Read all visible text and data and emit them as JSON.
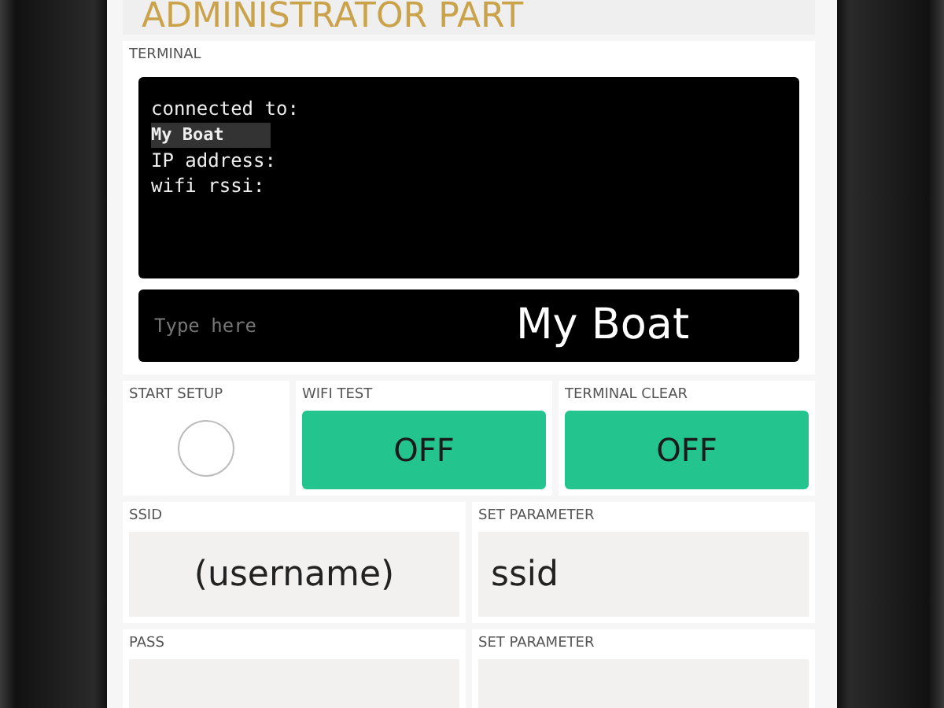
{
  "title": "ADMINISTRATOR PART",
  "terminal": {
    "label": "TERMINAL",
    "lines": [
      {
        "text": "connected to:",
        "highlighted": false
      },
      {
        "text": "My Boat",
        "highlighted": true
      },
      {
        "text": "IP address:",
        "highlighted": false
      },
      {
        "text": "wifi rssi:",
        "highlighted": false
      }
    ],
    "input": {
      "placeholder": "Type here",
      "value": "My Boat"
    }
  },
  "controls": [
    {
      "kind": "led",
      "label": "START SETUP",
      "on": false
    },
    {
      "kind": "button",
      "label": "WIFI TEST",
      "text": "OFF"
    },
    {
      "kind": "button",
      "label": "TERMINAL CLEAR",
      "text": "OFF"
    }
  ],
  "fields": [
    {
      "kind": "display",
      "label": "SSID",
      "value": "(username)"
    },
    {
      "kind": "input",
      "label": "SET PARAMETER",
      "value": "ssid"
    },
    {
      "kind": "display",
      "label": "PASS"
    },
    {
      "kind": "input",
      "label": "SET PARAMETER"
    }
  ]
}
